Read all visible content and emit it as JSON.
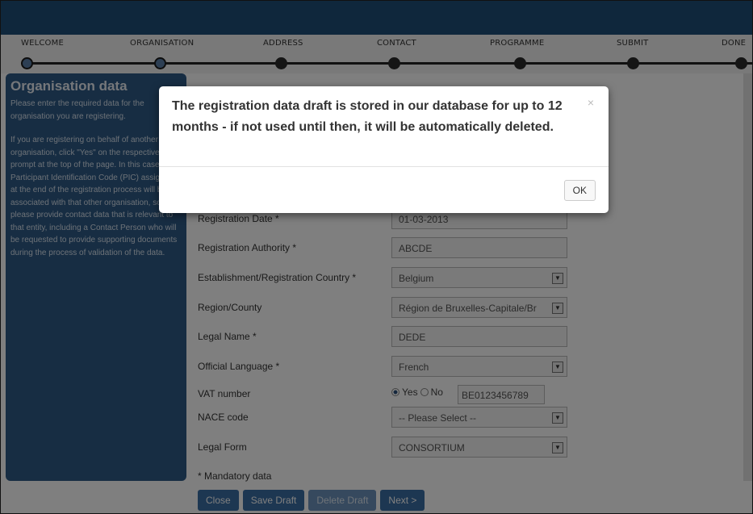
{
  "stepper": {
    "steps": [
      "WELCOME",
      "ORGANISATION",
      "ADDRESS",
      "CONTACT",
      "PROGRAMME",
      "SUBMIT",
      "DONE"
    ]
  },
  "sidebar": {
    "title": "Organisation data",
    "para1": "Please enter the required data for the organisation you are registering.",
    "para2": "If you are registering on behalf of another organisation, click \"Yes\" on the respective prompt at the top of the page. In this case the Participant Identification Code (PIC) assigned at the end of the registration process will be associated with that other organisation, so please provide contact data that is relevant to that entity, including a Contact Person who will be requested to provide supporting documents during the process of validation of the data."
  },
  "form": {
    "registration_date": {
      "label": "Registration Date *",
      "value": "01-03-2013"
    },
    "registration_authority": {
      "label": "Registration Authority *",
      "value": "ABCDE"
    },
    "country": {
      "label": "Establishment/Registration Country *",
      "value": "Belgium"
    },
    "region": {
      "label": "Region/County",
      "value": "Région de Bruxelles-Capitale/Br"
    },
    "legal_name": {
      "label": "Legal Name *",
      "value": "DEDE"
    },
    "official_language": {
      "label": "Official Language *",
      "value": "French"
    },
    "vat": {
      "label": "VAT number",
      "yes": "Yes",
      "no": "No",
      "value": "BE0123456789"
    },
    "nace": {
      "label": "NACE code",
      "value": "-- Please Select --"
    },
    "legal_form": {
      "label": "Legal Form",
      "value": "CONSORTIUM"
    },
    "mandatory_note": "* Mandatory data"
  },
  "buttons": {
    "close": "Close",
    "save_draft": "Save Draft",
    "delete_draft": "Delete Draft",
    "next": "Next >"
  },
  "modal": {
    "message": "The registration data draft is stored in our database for up to 12 months - if not used until then, it will be automatically deleted.",
    "close_glyph": "×",
    "ok": "OK"
  }
}
